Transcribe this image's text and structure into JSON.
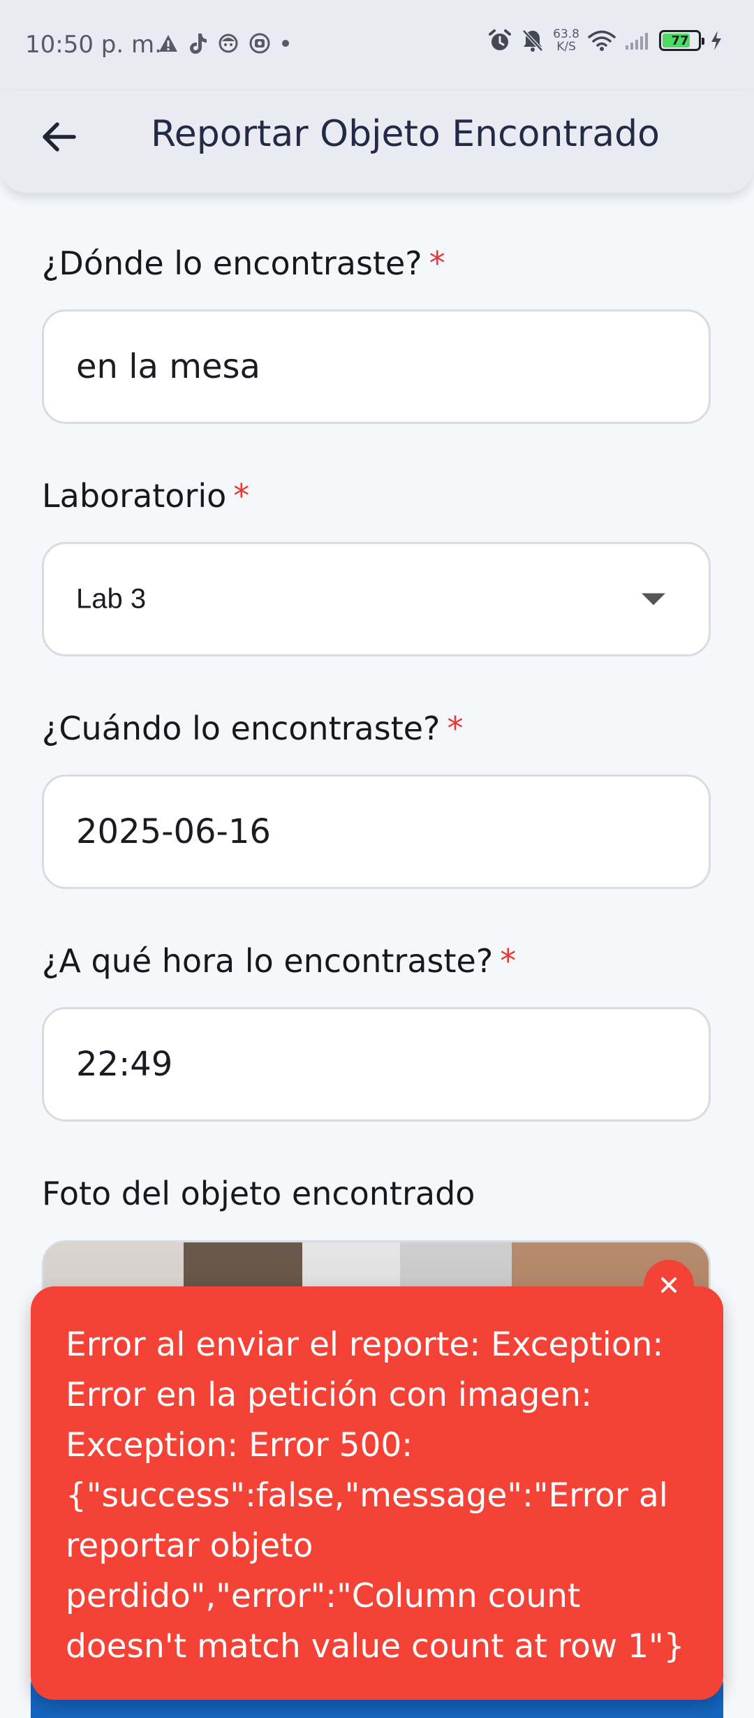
{
  "status_bar": {
    "time": "10:50 p. m.",
    "net_speed_value": "63.8",
    "net_speed_unit": "K/S",
    "battery_level": "77",
    "battery_fraction": 0.77,
    "left_icons": [
      "warning-icon",
      "tiktok-icon",
      "face-app-icon",
      "media-app-icon",
      "dot-icon"
    ],
    "right_icons": [
      "alarm-icon",
      "bell-off-icon",
      "wifi-icon",
      "signal-icon",
      "battery-icon",
      "charging-bolt-icon"
    ]
  },
  "app_bar": {
    "title": "Reportar Objeto Encontrado",
    "back_icon": "arrow-left-icon"
  },
  "form": {
    "location": {
      "label": "¿Dónde lo encontraste?",
      "required_mark": "*",
      "value": "en la mesa"
    },
    "laboratory": {
      "label": "Laboratorio",
      "required_mark": "*",
      "value": "Lab 3"
    },
    "date": {
      "label": "¿Cuándo lo encontraste?",
      "required_mark": "*",
      "value": "2025-06-16"
    },
    "time": {
      "label": "¿A qué hora lo encontraste?",
      "required_mark": "*",
      "value": "22:49"
    },
    "photo": {
      "label": "Foto del objeto encontrado"
    }
  },
  "snackbar": {
    "message": "Error al enviar el reporte: Exception:\nError en la petición con imagen:\nException: Error 500:\n{\"success\":false,\"message\":\"Error al\nreportar objeto\nperdido\",\"error\":\"Column count\ndoesn't match value count at row 1\"}",
    "close_icon": "close-icon"
  },
  "colors": {
    "accent": "#1565c0",
    "error": "#f44336",
    "required": "#e53935",
    "app_bar_bg": "#e9eaf2",
    "title_text": "#232a45"
  }
}
